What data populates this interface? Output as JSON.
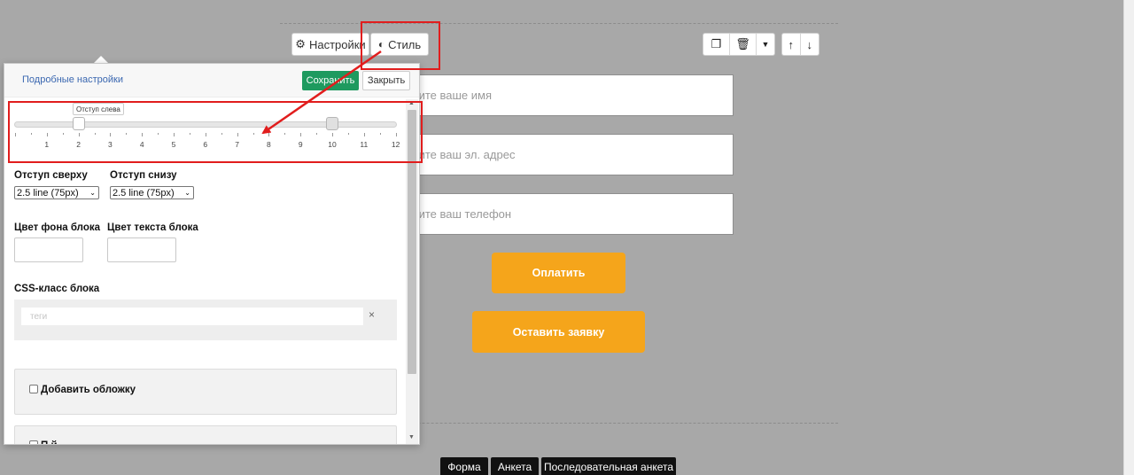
{
  "toolbar": {
    "settings_label": "Настройки",
    "style_label": "Стиль"
  },
  "panel": {
    "detailed_link": "Подробные настройки",
    "save_label": "Сохранить",
    "close_label": "Закрыть",
    "slider": {
      "tooltip": "Отступ слева",
      "ticks": [
        "1",
        "2",
        "3",
        "4",
        "5",
        "6",
        "7",
        "8",
        "9",
        "10",
        "11",
        "12"
      ],
      "left_value": 2,
      "right_value": 10
    },
    "top_margin": {
      "label": "Отступ сверху",
      "value": "2.5 line (75px)"
    },
    "bottom_margin": {
      "label": "Отступ снизу",
      "value": "2.5 line (75px)"
    },
    "bg_color_label": "Цвет фона блока",
    "text_color_label": "Цвет текста блока",
    "css_class": {
      "label": "CSS-класс блока",
      "placeholder": "теги"
    },
    "add_cover_label": "Добавить обложку",
    "next_card_label": "П                  й"
  },
  "form": {
    "name_placeholder": "дите ваше имя",
    "email_placeholder": "дите ваш эл. адрес",
    "phone_placeholder": "дите ваш телефон",
    "pay_label": "Оплатить",
    "request_label": "Оставить заявку"
  },
  "bottom_tabs": [
    "Форма",
    "Анкета",
    "Последовательная анкета"
  ],
  "colors": {
    "accent_green": "#1e9a5f",
    "accent_orange": "#f5a51b",
    "annotation_red": "#e11d1d"
  }
}
